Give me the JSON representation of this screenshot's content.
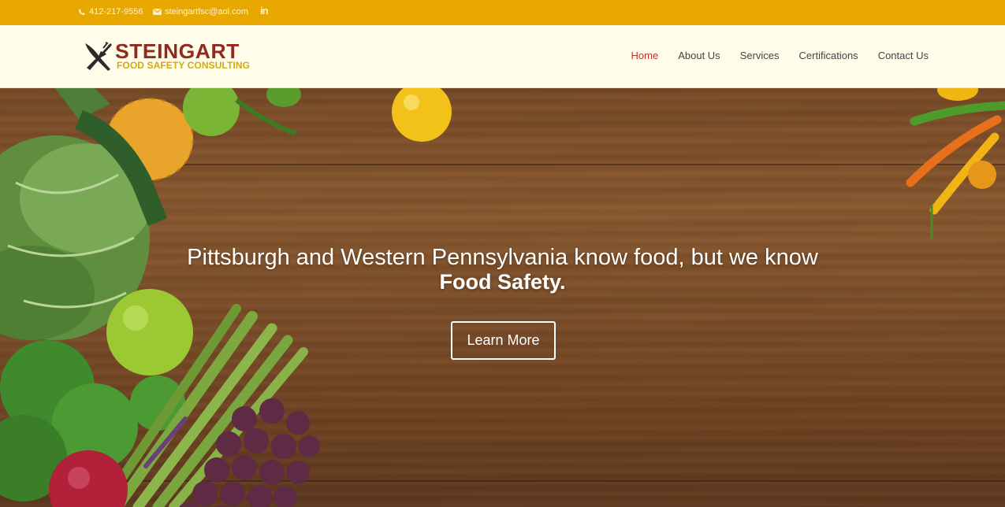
{
  "topbar": {
    "phone": "412-217-9556",
    "email": "steingartfsc@aol.com",
    "social_icon": "linkedin-icon",
    "social_text": "in"
  },
  "brand": {
    "name": "STEINGART",
    "tagline": "FOOD SAFETY CONSULTING",
    "logo_icon": "fork-knife-icon"
  },
  "nav": {
    "items": [
      {
        "label": "Home",
        "active": true
      },
      {
        "label": "About Us",
        "active": false
      },
      {
        "label": "Services",
        "active": false
      },
      {
        "label": "Certifications",
        "active": false
      },
      {
        "label": "Contact Us",
        "active": false
      }
    ]
  },
  "hero": {
    "headline": "Pittsburgh and Western Pennsylvania know food, but we know",
    "headline_emphasis": "Food Safety.",
    "cta_label": "Learn More"
  },
  "colors": {
    "topbar": "#e8a800",
    "header_bg": "#fffdea",
    "brand_red": "#8f2a1d",
    "brand_gold": "#d4a90e",
    "nav_active": "#b33a2e"
  }
}
